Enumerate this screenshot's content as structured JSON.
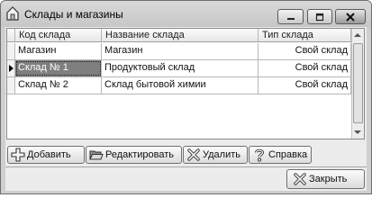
{
  "window": {
    "title": "Склады и магазины"
  },
  "table": {
    "columns": [
      "Код склада",
      "Название склада",
      "Тип склада"
    ],
    "rows": [
      {
        "code": "Магазин",
        "name": "Магазин",
        "type": "Свой склад",
        "selected": false
      },
      {
        "code": "Склад № 1",
        "name": "Продуктовый склад",
        "type": "Свой склад",
        "selected": true
      },
      {
        "code": "Склад № 2",
        "name": "Склад бытовой химии",
        "type": "Свой склад",
        "selected": false
      }
    ]
  },
  "actions": {
    "add": "Добавить",
    "edit": "Редактировать",
    "delete": "Удалить",
    "help": "Справка",
    "close": "Закрыть"
  },
  "icons": {
    "app": "house-icon",
    "add": "plus-icon",
    "edit": "folder-open-icon",
    "delete": "x-icon",
    "help": "question-icon",
    "close": "x-icon"
  }
}
